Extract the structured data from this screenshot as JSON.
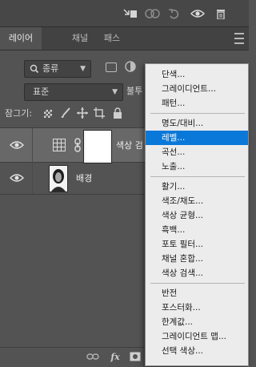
{
  "tabs": [
    {
      "label": "레이어",
      "active": true
    },
    {
      "label": "채널",
      "active": false
    },
    {
      "label": "패스",
      "active": false
    }
  ],
  "filter": {
    "kind_label": "종류"
  },
  "blend": {
    "mode": "표준",
    "opacity_label": "불투"
  },
  "lock": {
    "label": "잠그기:"
  },
  "layers": [
    {
      "name": "색상 검",
      "type": "adjustment"
    },
    {
      "name": "배경",
      "type": "image"
    }
  ],
  "adjustment_menu": {
    "groups": [
      [
        "단색...",
        "그레이디언트...",
        "패턴..."
      ],
      [
        "명도/대비...",
        "레벨...",
        "곡선...",
        "노출..."
      ],
      [
        "활기...",
        "색조/채도...",
        "색상 균형...",
        "흑백...",
        "포토 필터...",
        "채널 혼합...",
        "색상 검색..."
      ],
      [
        "반전",
        "포스터화...",
        "한계값...",
        "그레이디언트 맵...",
        "선택 색상..."
      ]
    ],
    "selected": "레벨..."
  },
  "icons": {
    "top": [
      "transform-selection-icon",
      "mask-icon",
      "visibility-link-icon",
      "reset-icon",
      "eye-icon",
      "trash-icon"
    ],
    "bottom": [
      "link-icon",
      "fx-icon",
      "add-mask-icon",
      "adjustment-icon",
      "group-icon",
      "new-layer-icon",
      "trash-icon"
    ]
  },
  "colors": {
    "selection": "#0a78d8",
    "checkmark": "#e01818",
    "panel": "#535353"
  }
}
